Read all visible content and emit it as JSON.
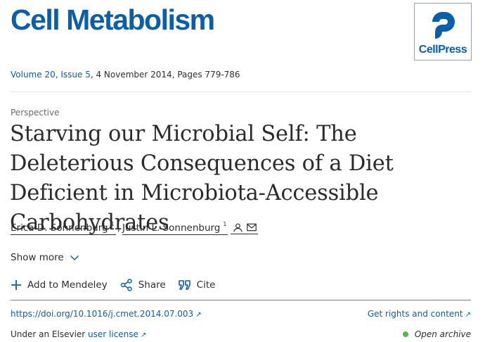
{
  "journal": {
    "name": "Cell Metabolism"
  },
  "publisher": {
    "name": "CellPress"
  },
  "citation": {
    "volume_issue": "Volume 20, Issue 5",
    "rest": ", 4 November 2014, Pages 779-786"
  },
  "article": {
    "type": "Perspective",
    "title": "Starving our Microbial Self: The Deleterious Consequences of a Diet Deficient in Microbiota-Accessible Carbohydrates"
  },
  "authors": [
    {
      "name": "Erica D. Sonnenburg",
      "affiliation": "1"
    },
    {
      "name": "Justin L. Sonnenburg",
      "affiliation": "1"
    }
  ],
  "author_separator": ",",
  "show_more": {
    "label": "Show more"
  },
  "actions": {
    "add_mendeley": "Add to Mendeley",
    "share": "Share",
    "cite": "Cite"
  },
  "links": {
    "doi": "https://doi.org/10.1016/j.cmet.2014.07.003",
    "rights": "Get rights and content",
    "license_prefix": "Under an Elsevier ",
    "license_link": "user license"
  },
  "access": {
    "label": "Open archive",
    "color": "#5ab54a"
  },
  "colors": {
    "brand": "#0b5ea8",
    "text": "#2e2e2e"
  },
  "icons": [
    "external-link-icon",
    "person-icon",
    "mail-icon",
    "chevron-down-icon",
    "plus-icon",
    "share-icon",
    "quote-icon"
  ]
}
